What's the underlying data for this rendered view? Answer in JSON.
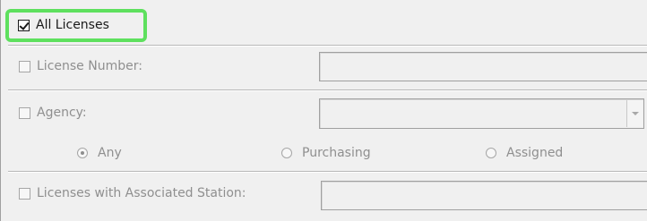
{
  "all_licenses": {
    "label": "All Licenses",
    "checked": true
  },
  "license_number": {
    "label": "License Number:",
    "value": ""
  },
  "agency": {
    "label": "Agency:",
    "selected": ""
  },
  "agency_scope": {
    "options": [
      "Any",
      "Purchasing",
      "Assigned"
    ],
    "selected": "Any"
  },
  "associated_station": {
    "label": "Licenses with Associated Station:",
    "value": ""
  },
  "colors": {
    "highlight": "#5ee05e",
    "disabled_text": "#8f8f8f"
  }
}
